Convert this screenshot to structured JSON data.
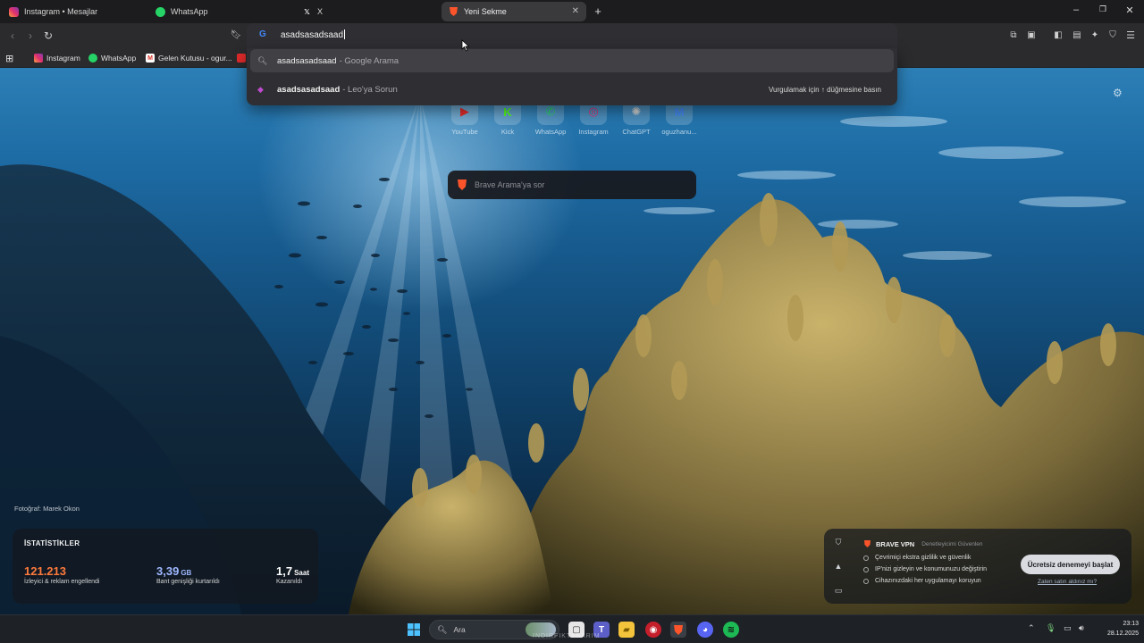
{
  "tabs": [
    {
      "title": "Instagram • Mesajlar",
      "icon": "instagram-icon",
      "active": false
    },
    {
      "title": "WhatsApp",
      "icon": "whatsapp-icon",
      "active": false
    },
    {
      "title": "X",
      "icon": "x-icon",
      "active": false
    },
    {
      "title": "Yeni Sekme",
      "icon": "brave-lion-icon",
      "active": true
    }
  ],
  "window_controls": {
    "minimize": "–",
    "restore": "❐",
    "close": "✕",
    "new_tab": "+"
  },
  "omnibox": {
    "value": "asadsasadsaad",
    "suggestions": [
      {
        "query": "asadsasadsaad",
        "suffix": "- Google Arama",
        "icon": "search-icon",
        "hint": ""
      },
      {
        "query": "asadsasadsaad",
        "suffix": "- Leo'ya Sorun",
        "icon": "leo-icon",
        "hint": "Vurgulamak için ↑ düğmesine basın"
      }
    ]
  },
  "bookmarks": [
    {
      "label": "Instagram",
      "icon": "instagram-icon"
    },
    {
      "label": "WhatsApp",
      "icon": "whatsapp-icon"
    },
    {
      "label": "Gelen Kutusu - ogur...",
      "icon": "gmail-icon"
    }
  ],
  "top_sites": [
    {
      "label": "YouTube",
      "glyph": "▶",
      "color": "#e02a2a"
    },
    {
      "label": "Kick",
      "glyph": "K",
      "color": "#53fc18"
    },
    {
      "label": "WhatsApp",
      "glyph": "✆",
      "color": "#25d366"
    },
    {
      "label": "Instagram",
      "glyph": "◎",
      "color": "#e1306c"
    },
    {
      "label": "ChatGPT",
      "glyph": "✺",
      "color": "#d0d0d0"
    },
    {
      "label": "oguzhanu...",
      "glyph": "M",
      "color": "#4285f4"
    }
  ],
  "search_box": {
    "placeholder": "Brave Arama'ya sor"
  },
  "photo_credit": "Fotoğraf: Marek Okon",
  "stats": {
    "title": "İSTATİSTİKLER",
    "items": [
      {
        "value": "121.213",
        "unit": "",
        "label": "İzleyici & reklam engellendi",
        "color": "#ff7a3d"
      },
      {
        "value": "3,39",
        "unit": "GB",
        "label": "Bant genişliği kurtarıldı",
        "color": "#9fb8ff"
      },
      {
        "value": "1,7",
        "unit": "Saat",
        "label": "Kazanıldı",
        "color": "#ffffff"
      }
    ]
  },
  "vpn": {
    "name": "BRAVE VPN",
    "tags": "Denetleyicimi   Güvenlen",
    "features": [
      "Çevrimiçi ekstra gizlilik ve güvenlik",
      "IP'nizi gizleyin ve konumunuzu değiştirin",
      "Cihazınızdaki her uygulamayı koruyun"
    ],
    "cta": "Ücretsiz denemeyi başlat",
    "link": "Zaten satın aldınız mı?"
  },
  "taskbar": {
    "search_placeholder": "Ara",
    "time": "23:13",
    "date": "28.12.2025",
    "overlay_text": "INDIRFIKTASARIM"
  },
  "colors": {
    "brave_orange": "#fb542b",
    "tab_active": "#3a3a3d",
    "toolbar": "#2b2b2e"
  }
}
